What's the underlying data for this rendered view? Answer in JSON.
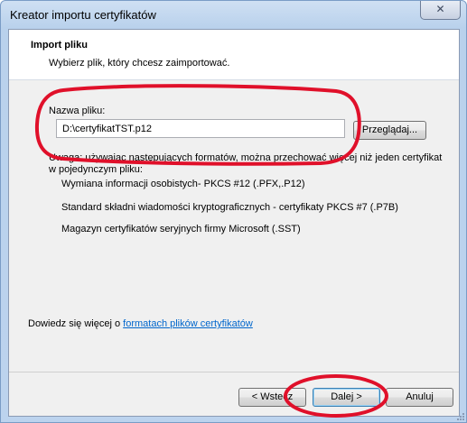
{
  "window": {
    "title": "Kreator importu certyfikatów",
    "close_glyph": "✕"
  },
  "header": {
    "title": "Import pliku",
    "subtitle": "Wybierz plik, który chcesz zaimportować."
  },
  "file": {
    "label": "Nazwa pliku:",
    "value": "D:\\certyfikatTST.p12",
    "browse_label": "Przeglądaj..."
  },
  "note": {
    "line1": "Uwaga: używając następujących formatów, można przechować więcej niż jeden certyfikat",
    "line2": "w pojedynczym pliku:",
    "formats": [
      "Wymiana informacji osobistych- PKCS #12 (.PFX,.P12)",
      "Standard składni wiadomości kryptograficznych - certyfikaty PKCS #7 (.P7B)",
      "Magazyn certyfikatów seryjnych firmy Microsoft (.SST)"
    ]
  },
  "more_info": {
    "prefix": "Dowiedz się więcej o ",
    "link": "formatach plików certyfikatów"
  },
  "buttons": {
    "back": "< Wstecz",
    "next": "Dalej >",
    "cancel": "Anuluj"
  },
  "colors": {
    "annotation": "#e0102a",
    "link": "#0066cc"
  }
}
